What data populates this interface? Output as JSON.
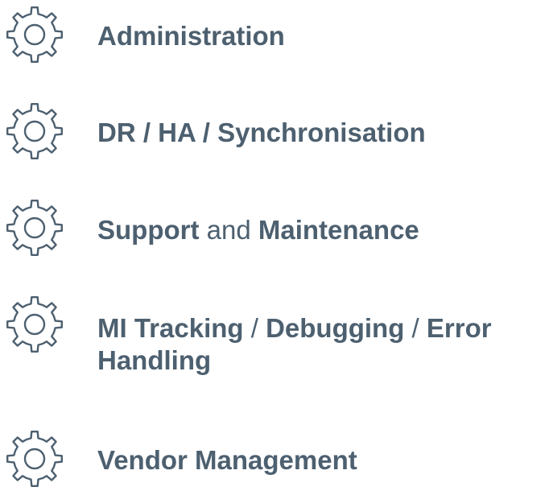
{
  "items": [
    {
      "icon": "gear-icon",
      "parts": [
        {
          "text": "Administration",
          "bold": true
        }
      ]
    },
    {
      "icon": "gear-icon",
      "parts": [
        {
          "text": "DR / HA / Synchronisation",
          "bold": true
        }
      ]
    },
    {
      "icon": "gear-icon",
      "parts": [
        {
          "text": "Support",
          "bold": true
        },
        {
          "text": " and ",
          "bold": false
        },
        {
          "text": "Maintenance",
          "bold": true
        }
      ]
    },
    {
      "icon": "gear-icon",
      "parts": [
        {
          "text": "MI Tracking",
          "bold": true
        },
        {
          "text": " / ",
          "bold": false
        },
        {
          "text": "Debugging",
          "bold": true
        },
        {
          "text": " / ",
          "bold": false
        },
        {
          "text": "Error Handling",
          "bold": true
        }
      ]
    },
    {
      "icon": "gear-icon",
      "parts": [
        {
          "text": "Vendor Management",
          "bold": true
        }
      ]
    }
  ],
  "colors": {
    "text": "#4d6070",
    "icon": "#4d6070",
    "background": "#ffffff"
  }
}
